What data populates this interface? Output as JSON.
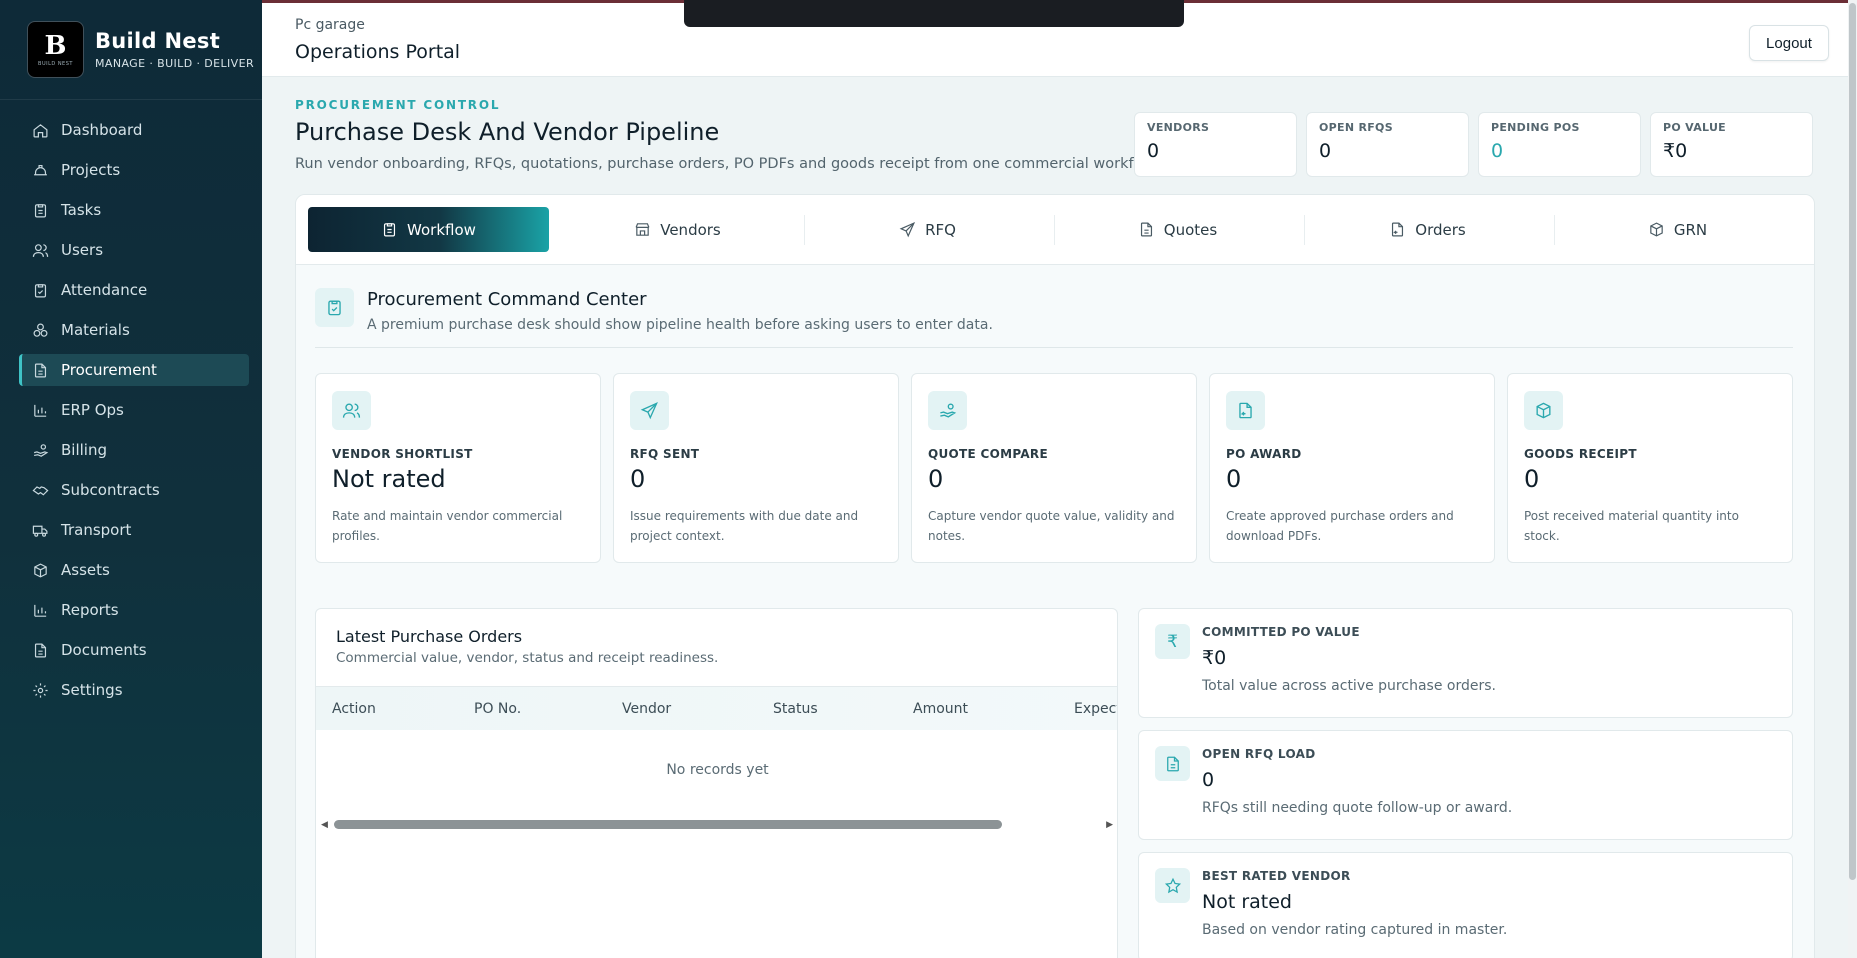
{
  "brand": {
    "name": "Build Nest",
    "tagline": "MANAGE · BUILD · DELIVER",
    "logo_text": "BUILD NEST"
  },
  "sidebar": {
    "items": [
      {
        "label": "Dashboard",
        "icon": "home-icon"
      },
      {
        "label": "Projects",
        "icon": "helmet-icon"
      },
      {
        "label": "Tasks",
        "icon": "clipboard-icon"
      },
      {
        "label": "Users",
        "icon": "users-icon"
      },
      {
        "label": "Attendance",
        "icon": "clipboard-check-icon"
      },
      {
        "label": "Materials",
        "icon": "boxes-icon"
      },
      {
        "label": "Procurement",
        "icon": "document-icon",
        "active": true
      },
      {
        "label": "ERP Ops",
        "icon": "bar-chart-icon"
      },
      {
        "label": "Billing",
        "icon": "hand-coins-icon"
      },
      {
        "label": "Subcontracts",
        "icon": "handshake-icon"
      },
      {
        "label": "Transport",
        "icon": "truck-icon"
      },
      {
        "label": "Assets",
        "icon": "package-icon"
      },
      {
        "label": "Reports",
        "icon": "bar-chart-icon"
      },
      {
        "label": "Documents",
        "icon": "file-text-icon"
      },
      {
        "label": "Settings",
        "icon": "gear-icon"
      }
    ]
  },
  "topbar": {
    "org": "Pc garage",
    "portal": "Operations Portal",
    "logout_label": "Logout"
  },
  "header": {
    "eyebrow": "PROCUREMENT CONTROL",
    "title": "Purchase Desk And Vendor Pipeline",
    "subtitle": "Run vendor onboarding, RFQs, quotations, purchase orders, PO PDFs and goods receipt from one commercial workflow."
  },
  "kpis": [
    {
      "label": "VENDORS",
      "value": "0"
    },
    {
      "label": "OPEN RFQS",
      "value": "0"
    },
    {
      "label": "PENDING POS",
      "value": "0"
    },
    {
      "label": "PO VALUE",
      "value": "₹0"
    }
  ],
  "tabs": [
    {
      "label": "Workflow",
      "icon": "clipboard-icon"
    },
    {
      "label": "Vendors",
      "icon": "store-icon"
    },
    {
      "label": "RFQ",
      "icon": "send-icon"
    },
    {
      "label": "Quotes",
      "icon": "file-text-icon"
    },
    {
      "label": "Orders",
      "icon": "file-return-icon"
    },
    {
      "label": "GRN",
      "icon": "package-icon"
    }
  ],
  "command_center": {
    "title": "Procurement Command Center",
    "subtitle": "A premium purchase desk should show pipeline health before asking users to enter data."
  },
  "stages": [
    {
      "label": "VENDOR SHORTLIST",
      "value": "Not rated",
      "desc": "Rate and maintain vendor commercial profiles.",
      "icon": "users-icon"
    },
    {
      "label": "RFQ SENT",
      "value": "0",
      "desc": "Issue requirements with due date and project context.",
      "icon": "send-icon"
    },
    {
      "label": "QUOTE COMPARE",
      "value": "0",
      "desc": "Capture vendor quote value, validity and notes.",
      "icon": "hand-coins-icon"
    },
    {
      "label": "PO AWARD",
      "value": "0",
      "desc": "Create approved purchase orders and download PDFs.",
      "icon": "file-return-icon"
    },
    {
      "label": "GOODS RECEIPT",
      "value": "0",
      "desc": "Post received material quantity into stock.",
      "icon": "package-icon"
    }
  ],
  "orders": {
    "title": "Latest Purchase Orders",
    "subtitle": "Commercial value, vendor, status and receipt readiness.",
    "columns": [
      "Action",
      "PO No.",
      "Vendor",
      "Status",
      "Amount",
      "Expect"
    ],
    "empty": "No records yet"
  },
  "metrics": [
    {
      "label": "COMMITTED PO VALUE",
      "value": "₹0",
      "desc": "Total value across active purchase orders.",
      "icon": "rupee-icon",
      "glyph": "₹"
    },
    {
      "label": "OPEN RFQ LOAD",
      "value": "0",
      "desc": "RFQs still needing quote follow-up or award.",
      "icon": "file-text-icon"
    },
    {
      "label": "BEST RATED VENDOR",
      "value": "Not rated",
      "desc": "Based on vendor rating captured in master.",
      "icon": "star-icon"
    }
  ],
  "colors": {
    "accent": "#2aa8ae",
    "sidebar": "#0e2a38",
    "active_tab": "#123845"
  }
}
